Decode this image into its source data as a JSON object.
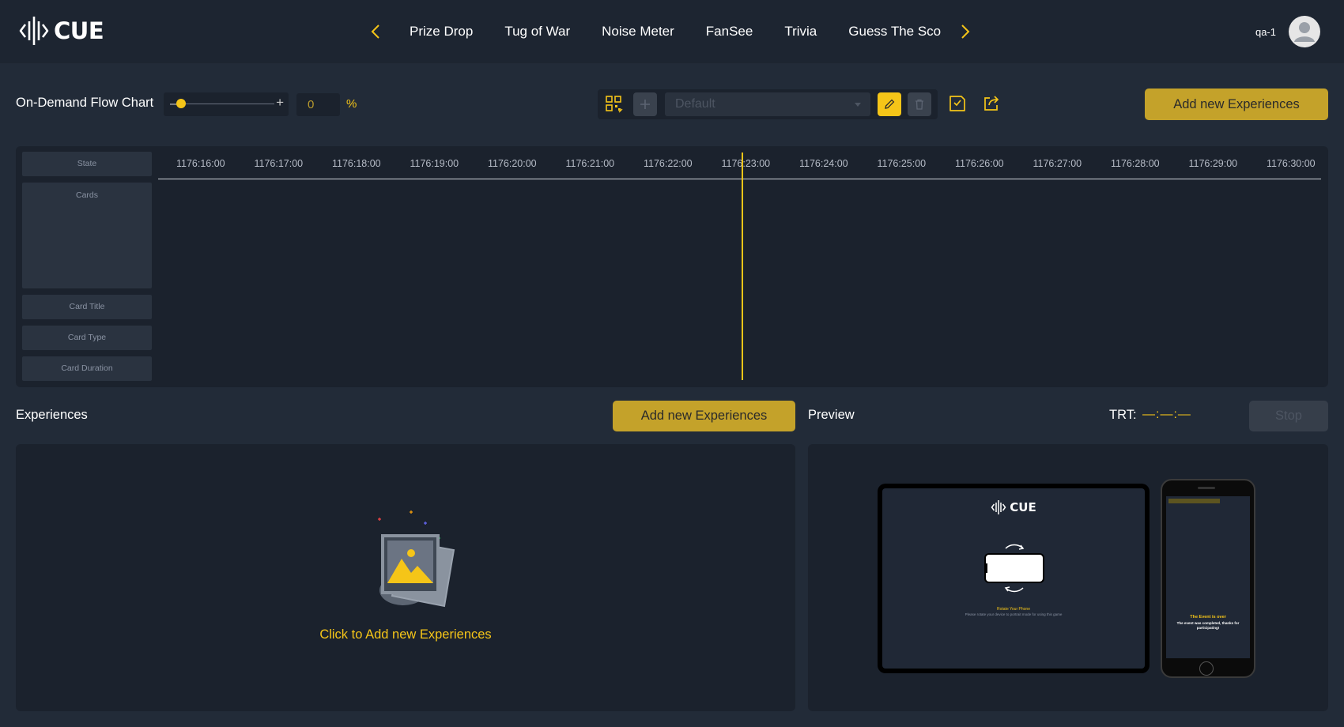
{
  "app": {
    "logo_text": "CUE"
  },
  "nav": {
    "items": [
      {
        "label": "Prize Drop"
      },
      {
        "label": "Tug of War"
      },
      {
        "label": "Noise Meter"
      },
      {
        "label": "FanSee"
      },
      {
        "label": "Trivia"
      },
      {
        "label": "Guess The Sco"
      }
    ]
  },
  "user": {
    "name": "qa-1"
  },
  "flowchart": {
    "title": "On-Demand Flow Chart",
    "zoom_minus": "–",
    "zoom_plus": "+",
    "zoom_level": 0,
    "percent_value": "0",
    "percent_sign": "%",
    "preset_placeholder": "Default",
    "add_button": "Add new Experiences"
  },
  "timeline": {
    "row_labels": [
      "State",
      "Cards",
      "Card Title",
      "Card Type",
      "Card Duration"
    ],
    "ticks": [
      "1176:16:00",
      "1176:17:00",
      "1176:18:00",
      "1176:19:00",
      "1176:20:00",
      "1176:21:00",
      "1176:22:00",
      "1176:23:00",
      "1176:24:00",
      "1176:25:00",
      "1176:26:00",
      "1176:27:00",
      "1176:28:00",
      "1176:29:00",
      "1176:30:00"
    ]
  },
  "experiences": {
    "title": "Experiences",
    "add_button": "Add new Experiences",
    "empty_text": "Click to Add new Experiences"
  },
  "preview": {
    "title": "Preview",
    "trt_label": "TRT:",
    "trt_value": "—:—:—",
    "stop_button": "Stop",
    "tablet_logo": "CUE",
    "tablet_rotate_title": "Rotate Your Phone",
    "tablet_rotate_sub": "Please rotate your device to portrait mode for using this game",
    "phone_title": "The Event is over",
    "phone_sub": "The event was completed, thanks for participating!"
  },
  "colors": {
    "accent": "#f5c518",
    "button": "#c4a22a",
    "background": "#222b38",
    "panel": "#1b222d",
    "topbar": "#1d2531"
  },
  "icons": [
    "logo-waveform-icon",
    "chevron-left-icon",
    "chevron-right-icon",
    "user-avatar-icon",
    "qr-code-icon",
    "plus-icon",
    "chevron-down-icon",
    "pencil-icon",
    "trash-icon",
    "save-icon",
    "share-icon",
    "image-placeholder-icon",
    "rotate-phone-icon"
  ]
}
